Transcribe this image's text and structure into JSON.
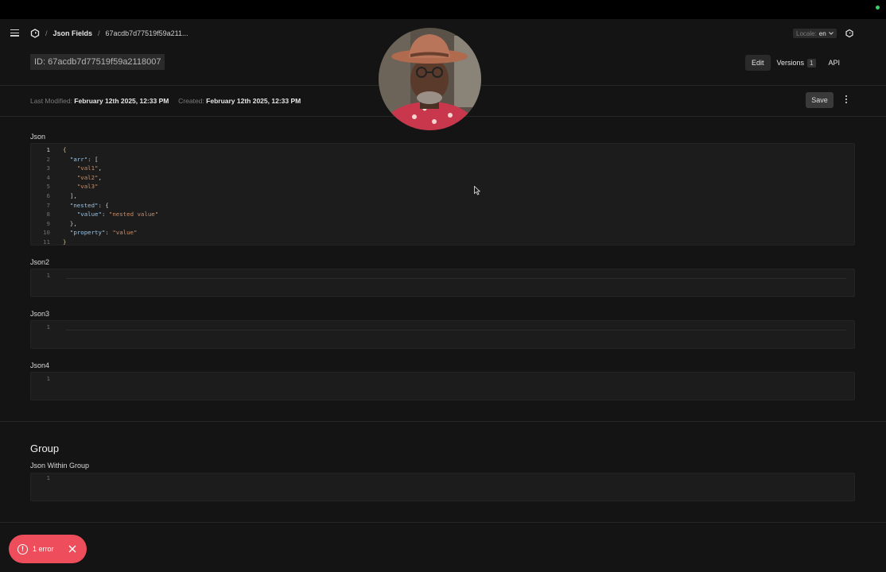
{
  "breadcrumb": {
    "separator": "/",
    "collection": "Json Fields",
    "document": "67acdb7d77519f59a211..."
  },
  "locale": {
    "label": "Locale:",
    "value": "en"
  },
  "document": {
    "id_label": "ID: 67acdb7d77519f59a2118007"
  },
  "tabs": [
    {
      "label": "Edit"
    },
    {
      "label": "Versions",
      "count": "1"
    },
    {
      "label": "API"
    }
  ],
  "meta": {
    "last_modified_label": "Last Modified:",
    "last_modified_value": "February 12th 2025, 12:33 PM",
    "created_label": "Created:",
    "created_value": "February 12th 2025, 12:33 PM"
  },
  "actions": {
    "save_label": "Save"
  },
  "fields": {
    "json": {
      "label": "Json",
      "lines": [
        "{",
        "  \"arr\": [",
        "    \"val1\",",
        "    \"val2\",",
        "    \"val3\"",
        "  ],",
        "  \"nested\": {",
        "    \"value\": \"nested value\"",
        "  },",
        "  \"property\": \"value\"",
        "}"
      ]
    },
    "json2": {
      "label": "Json2",
      "line_number": "1"
    },
    "json3": {
      "label": "Json3",
      "line_number": "1"
    },
    "json4": {
      "label": "Json4",
      "line_number": "1"
    }
  },
  "group": {
    "title": "Group",
    "field_label": "Json Within Group",
    "line_number": "1"
  },
  "toast": {
    "message": "1 error"
  },
  "colors": {
    "background": "#141414",
    "editor_bg": "#1c1c1c",
    "toast_bg": "#ee4d5c",
    "json_key": "#9cc4e4",
    "json_string": "#c58f6d",
    "json_punct": "#cfcfcf",
    "recording_dot": "#35d46a"
  }
}
